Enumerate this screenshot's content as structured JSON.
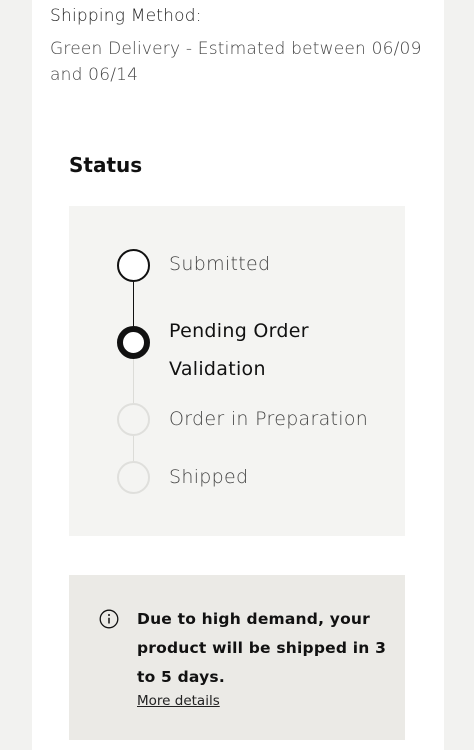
{
  "shipping": {
    "label": "Shipping Method:",
    "value": "Green Delivery - Estimated between 06/09 and 06/14"
  },
  "status": {
    "title": "Status",
    "steps": [
      {
        "label": "Submitted",
        "state": "done"
      },
      {
        "label": "Pending Order Validation",
        "state": "current"
      },
      {
        "label": "Order in Preparation",
        "state": "upcoming"
      },
      {
        "label": "Shipped",
        "state": "upcoming"
      }
    ]
  },
  "notice": {
    "icon": "info-icon",
    "text": "Due to high demand, your product will be shipped in 3 to 5 days.",
    "link": "More details"
  },
  "colors": {
    "page_bg": "#f2f2f0",
    "timeline_bg": "#f4f4f2",
    "notice_bg": "#ebeae6",
    "active": "#111111",
    "inactive": "#dcdcd8"
  }
}
